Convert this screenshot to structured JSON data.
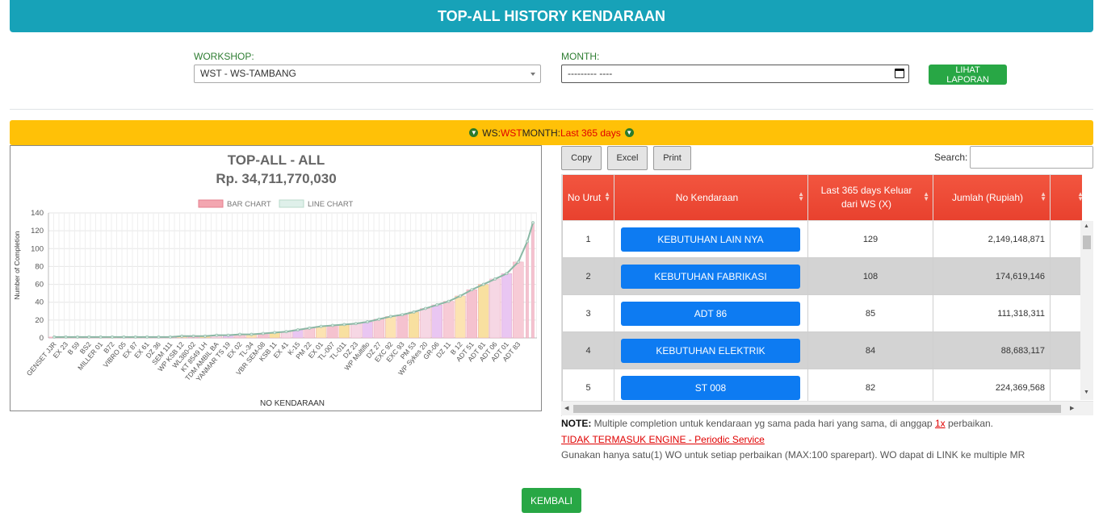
{
  "header": {
    "title": "TOP-ALL HISTORY KENDARAAN"
  },
  "filters": {
    "workshop_label": "WORKSHOP:",
    "workshop_value": "WST - WS-TAMBANG",
    "month_label": "MONTH:",
    "month_value": "--------- ----",
    "submit_label": "LIHAT LAPORAN"
  },
  "banner": {
    "ws_label": "WS:",
    "ws_value": "WST",
    "month_label": " MONTH:",
    "month_value": "Last 365 days"
  },
  "chart_data": {
    "type": "bar",
    "title": "TOP-ALL - ALL",
    "subtitle": "Rp. 34,711,770,030",
    "xlabel": "NO KENDARAAN",
    "ylabel": "Number of Completion",
    "ylim": [
      0,
      140
    ],
    "yticks": [
      0,
      20,
      40,
      60,
      80,
      100,
      120,
      140
    ],
    "grid": true,
    "legend": "top",
    "series": [
      {
        "name": "BAR CHART",
        "color": "#e57f8e"
      },
      {
        "name": "LINE CHART",
        "color": "#8ab8a5"
      }
    ],
    "categories": [
      "GENSET JJR",
      "EX 23",
      "B 59",
      "BS2",
      "MILLER 01",
      "B72",
      "VIBRO 05",
      "EX 87",
      "EX 61",
      "DZ 36",
      "SEM 111",
      "WP KSB 12",
      "WL380-02",
      "KT 8549 LH",
      "TDM AMBIL BA",
      "YANMAR TS 19",
      "EX 02",
      "TL-34",
      "VBR SEM-08",
      "KSB 11",
      "EX 41",
      "K-15",
      "PM 22",
      "EX 01",
      "TL-007",
      "TL-011",
      "DZ 23",
      "WP Multiflo",
      "DZ 27",
      "EXC 92",
      "EXC 93",
      "PM 53",
      "WP Sykes 20",
      "GR-06",
      "DZ 11",
      "B 12",
      "ADT 51",
      "ADT 81",
      "ADT 06",
      "ADT 01",
      "ADT 83"
    ],
    "values": [
      1,
      1,
      1,
      1,
      1,
      1,
      1,
      1,
      1,
      1,
      1,
      2,
      2,
      2,
      3,
      3,
      4,
      4,
      5,
      6,
      7,
      9,
      11,
      13,
      14,
      15,
      16,
      18,
      21,
      24,
      26,
      29,
      33,
      37,
      41,
      47,
      54,
      60,
      66,
      72,
      85
    ],
    "top_values": [
      108,
      129
    ]
  },
  "table": {
    "buttons": [
      "Copy",
      "Excel",
      "Print"
    ],
    "search_label": "Search:",
    "columns": [
      "No Urut",
      "No Kendaraan",
      "Last 365 days Keluar dari WS (X)",
      "Jumlah (Rupiah)",
      ""
    ],
    "rows": [
      {
        "no": "1",
        "vehicle": "KEBUTUHAN LAIN NYA",
        "count": "129",
        "amount": "2,149,148,871"
      },
      {
        "no": "2",
        "vehicle": "KEBUTUHAN FABRIKASI",
        "count": "108",
        "amount": "174,619,146"
      },
      {
        "no": "3",
        "vehicle": "ADT 86",
        "count": "85",
        "amount": "111,318,311"
      },
      {
        "no": "4",
        "vehicle": "KEBUTUHAN ELEKTRIK",
        "count": "84",
        "amount": "88,683,117"
      },
      {
        "no": "5",
        "vehicle": "ST 008",
        "count": "82",
        "amount": "224,369,568"
      }
    ]
  },
  "notes": {
    "note_label": "NOTE:",
    "note_text": " Multiple completion untuk kendaraan yg sama pada hari yang sama, di anggap ",
    "note_highlight": "1x",
    "note_tail": " perbaikan.",
    "engine_link": "TIDAK TERMASUK ENGINE - Periodic Service",
    "wo_text": "Gunakan hanya satu(1) WO untuk setiap perbaikan (MAX:100 sparepart). WO dapat di LINK ke multiple MR"
  },
  "back_button": "KEMBALI"
}
